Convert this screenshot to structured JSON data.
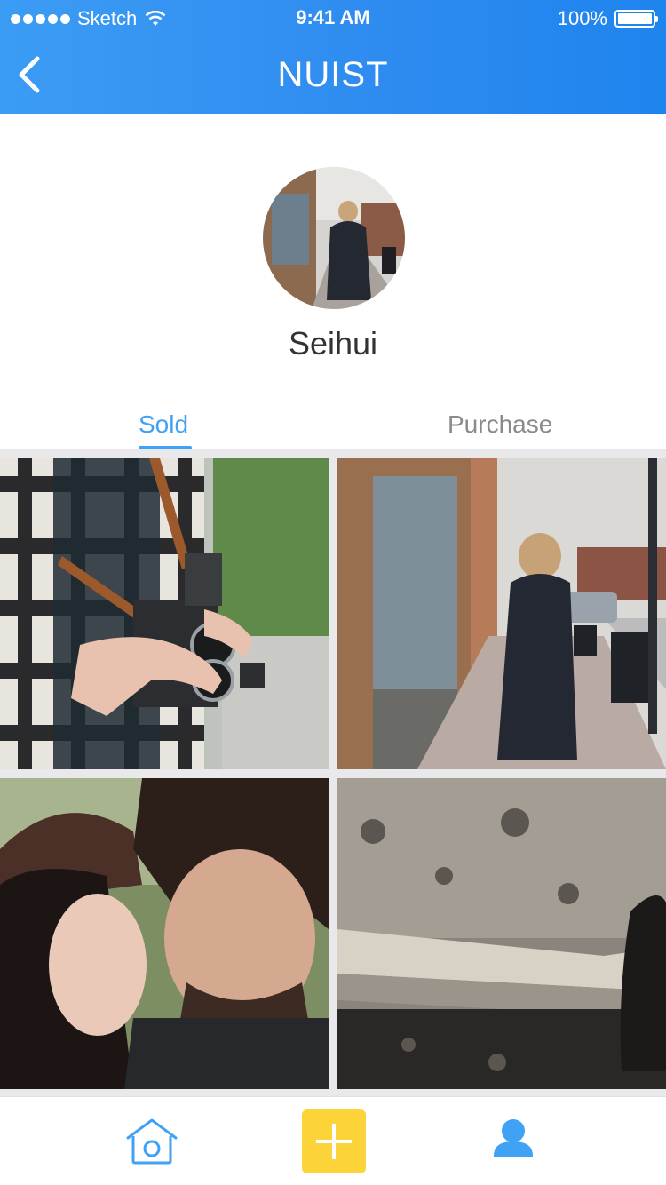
{
  "status_bar": {
    "carrier": "Sketch",
    "time": "9:41 AM",
    "battery": "100%",
    "battery_level": 1.0
  },
  "header": {
    "title": "NUIST",
    "back_icon": "chevron-left-icon"
  },
  "profile": {
    "username": "Seihui"
  },
  "tabs": [
    {
      "label": "Sold",
      "active": true
    },
    {
      "label": "Purchase",
      "active": false
    }
  ],
  "photos": [
    {
      "subject": "camera-photo"
    },
    {
      "subject": "street-walk-photo"
    },
    {
      "subject": "couple-photo"
    },
    {
      "subject": "rubble-photo"
    }
  ],
  "tab_bar": {
    "home_icon": "home-icon",
    "add_icon": "plus-icon",
    "profile_icon": "user-icon"
  },
  "colors": {
    "header_blue": "#2f8cf0",
    "accent": "#3fa2f5",
    "add_button": "#fcd43a"
  }
}
